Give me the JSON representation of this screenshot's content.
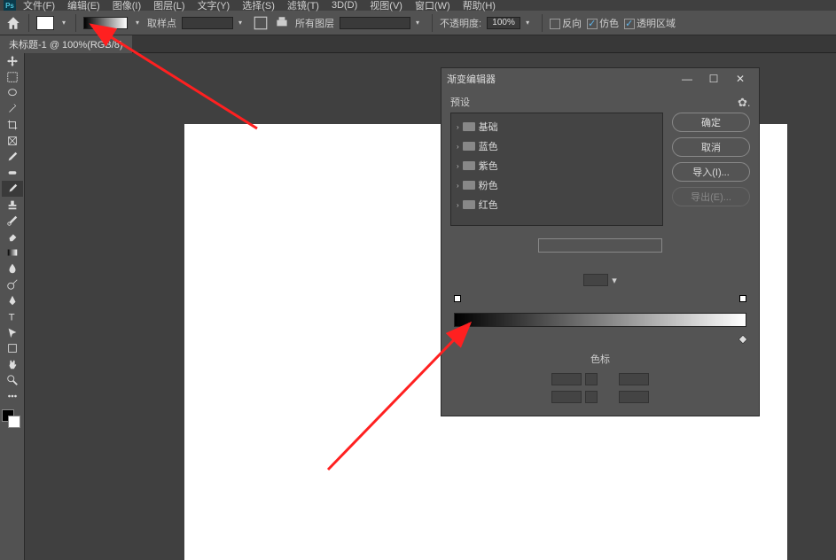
{
  "menubar": {
    "items": [
      "文件(F)",
      "编辑(E)",
      "图像(I)",
      "图层(L)",
      "文字(Y)",
      "选择(S)",
      "滤镜(T)",
      "3D(D)",
      "视图(V)",
      "窗口(W)",
      "帮助(H)"
    ]
  },
  "optionsbar": {
    "sample_label": "取样点",
    "layers_label": "所有图层",
    "opacity_label": "不透明度:",
    "opacity_value": "100%",
    "reverse_label": "反向",
    "dither_label": "仿色",
    "transparency_label": "透明区域"
  },
  "doctab": "未标题-1 @ 100%(RGB/8)",
  "dialog": {
    "title": "渐变编辑器",
    "presets_label": "预设",
    "folders": [
      "基础",
      "蓝色",
      "紫色",
      "粉色",
      "红色"
    ],
    "buttons": {
      "ok": "确定",
      "cancel": "取消",
      "import": "导入(I)...",
      "export": "导出(E)..."
    },
    "stops_label": "色标"
  },
  "tools": [
    "move",
    "marquee",
    "lasso",
    "wand",
    "crop",
    "frame",
    "eyedropper",
    "heal",
    "brush",
    "stamp",
    "history",
    "eraser",
    "gradient",
    "blur",
    "dodge",
    "pen",
    "text",
    "path",
    "rect",
    "hand",
    "zoom",
    "more"
  ]
}
